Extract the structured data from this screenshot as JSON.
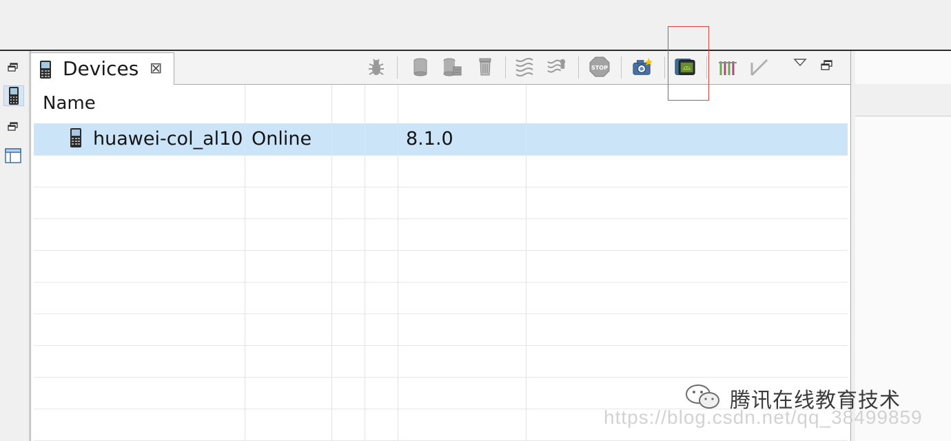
{
  "tab": {
    "title": "Devices",
    "close_glyph": "⊠"
  },
  "toolbar": {
    "icons": [
      "debug-icon",
      "update-heap-icon",
      "dump-hprof-icon",
      "cause-gc-icon",
      "update-threads-icon",
      "start-method-profiling-icon",
      "stop-process-icon",
      "screen-capture-icon",
      "dump-view-hierarchy-icon",
      "systrace-icon",
      "opengl-trace-icon",
      "view-menu-chevron-icon",
      "restore-icon"
    ]
  },
  "table": {
    "headers": [
      "Name",
      "",
      "",
      "",
      "",
      ""
    ],
    "rows": [
      {
        "name": "huawei-col_al10",
        "state": "Online",
        "col3": "",
        "col4": "",
        "version": "8.1.0",
        "col6": ""
      }
    ]
  },
  "watermark": {
    "brand": "腾讯在线教育技术",
    "url": "https://blog.csdn.net/qq_38499859"
  },
  "colors": {
    "selection": "#cce4f7",
    "highlight_box": "#e0443a",
    "android_green": "#9acd32"
  }
}
